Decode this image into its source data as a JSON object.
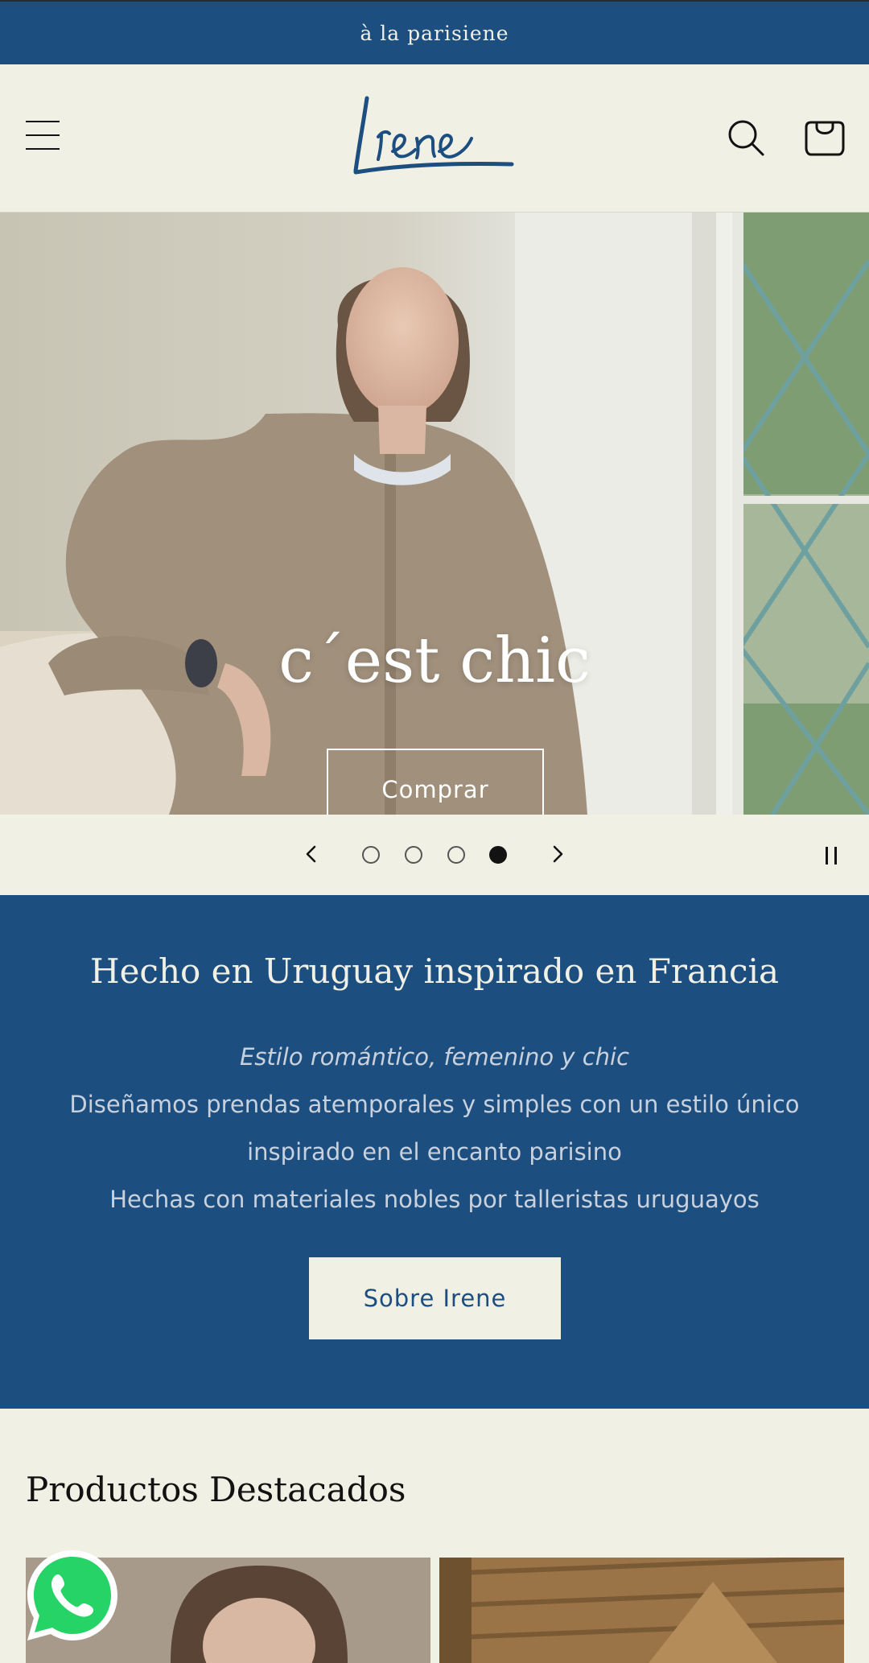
{
  "announcement": {
    "text": "à la parisiene"
  },
  "header": {
    "logo_text": "Irene"
  },
  "hero": {
    "title": "c´est chic",
    "button_label": "Comprar"
  },
  "slideshow": {
    "slide_count": 4,
    "active_slide": 4
  },
  "about": {
    "title": "Hecho en Uruguay inspirado en Francia",
    "lines": [
      "Estilo romántico, femenino y chic",
      "Diseñamos prendas atemporales y simples con un estilo único",
      "inspirado en el encanto parisino",
      "Hechas con materiales nobles por talleristas uruguayos"
    ],
    "button_label": "Sobre Irene"
  },
  "featured": {
    "title": "Productos Destacados"
  },
  "colors": {
    "brand_blue": "#1d4e80",
    "cream": "#f1f0e4",
    "text_dark": "#121212",
    "whatsapp_green": "#25d366"
  }
}
